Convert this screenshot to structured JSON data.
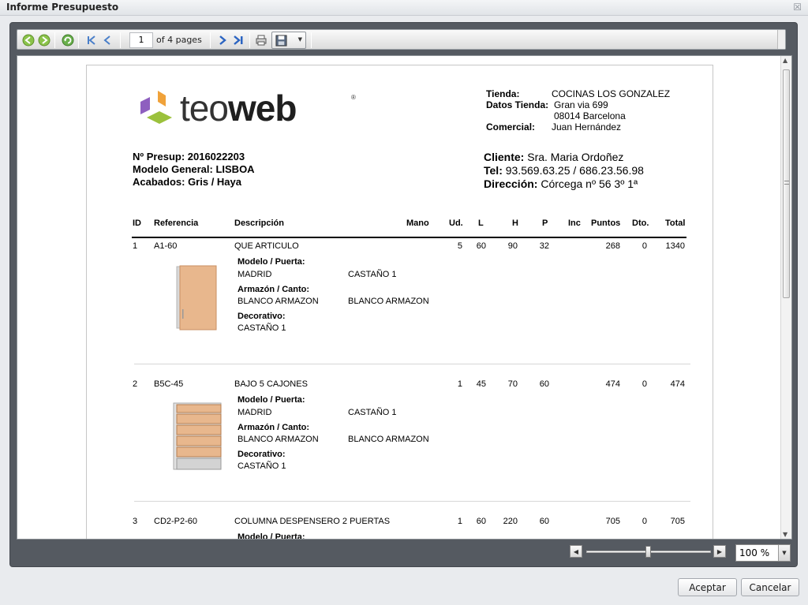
{
  "dialog": {
    "title": "Informe Presupuesto",
    "close_label": "☒"
  },
  "toolbar": {
    "page_value": "1",
    "page_of": "of 4 pages",
    "icons": [
      "back-icon",
      "forward-icon",
      "refresh-icon",
      "first-page-icon",
      "prev-page-icon",
      "next-page-icon",
      "last-page-icon",
      "print-icon",
      "save-icon"
    ]
  },
  "report": {
    "logo": {
      "light": "teo",
      "bold": "web",
      "reg": "®"
    },
    "store": [
      {
        "label": "Tienda:",
        "value": "COCINAS LOS GONZALEZ"
      },
      {
        "label": "Datos Tienda:",
        "value": "Gran via 699"
      },
      {
        "label": "",
        "value": "08014 Barcelona"
      },
      {
        "label": "Comercial:",
        "value": "Juan Hernández"
      }
    ],
    "presup": "Nº Presup:  2016022203",
    "modelo": "Modelo General: LISBOA",
    "acabados": "Acabados: Gris / Haya",
    "cliente_label": "Cliente:",
    "cliente_value": "Sra. Maria Ordoñez",
    "tel_label": "Tel:",
    "tel_value": "93.569.63.25 / 686.23.56.98",
    "dir_label": "Dirección:",
    "dir_value": "Córcega nº 56 3º 1ª",
    "columns": {
      "id": "ID",
      "ref": "Referencia",
      "desc": "Descripción",
      "mano": "Mano",
      "ud": "Ud.",
      "l": "L",
      "h": "H",
      "p": "P",
      "inc": "Inc",
      "puntos": "Puntos",
      "dto": "Dto.",
      "total": "Total"
    },
    "items": [
      {
        "id": "1",
        "ref": "A1-60",
        "desc": "QUE ARTICULO",
        "ud": "5",
        "l": "60",
        "h": "90",
        "p": "32",
        "puntos": "268",
        "dto": "0",
        "total": "1340",
        "modelo_label": "Modelo / Puerta:",
        "modelo_a": "MADRID",
        "modelo_b": "CASTAÑO 1",
        "armazon_label": "Armazón / Canto:",
        "armazon_a": "BLANCO ARMAZON",
        "armazon_b": "BLANCO ARMAZON",
        "decor_label": "Decorativo:",
        "decor_a": "CASTAÑO 1"
      },
      {
        "id": "2",
        "ref": "B5C-45",
        "desc": "BAJO 5 CAJONES",
        "ud": "1",
        "l": "45",
        "h": "70",
        "p": "60",
        "puntos": "474",
        "dto": "0",
        "total": "474",
        "modelo_label": "Modelo / Puerta:",
        "modelo_a": "MADRID",
        "modelo_b": "CASTAÑO 1",
        "armazon_label": "Armazón / Canto:",
        "armazon_a": "BLANCO ARMAZON",
        "armazon_b": "BLANCO ARMAZON",
        "decor_label": "Decorativo:",
        "decor_a": "CASTAÑO 1"
      },
      {
        "id": "3",
        "ref": "CD2-P2-60",
        "desc": "COLUMNA DESPENSERO 2 PUERTAS",
        "ud": "1",
        "l": "60",
        "h": "220",
        "p": "60",
        "puntos": "705",
        "dto": "0",
        "total": "705",
        "modelo_label": "Modelo / Puerta:"
      }
    ]
  },
  "zoom": {
    "value": "100 %",
    "level_percent": 100
  },
  "buttons": {
    "accept": "Aceptar",
    "cancel": "Cancelar"
  },
  "colors": {
    "frame": "#555a61",
    "logo_purple": "#8e5fbf",
    "logo_orange": "#f0a23a",
    "logo_green": "#9bc13c",
    "wood": "#e8b78d"
  }
}
